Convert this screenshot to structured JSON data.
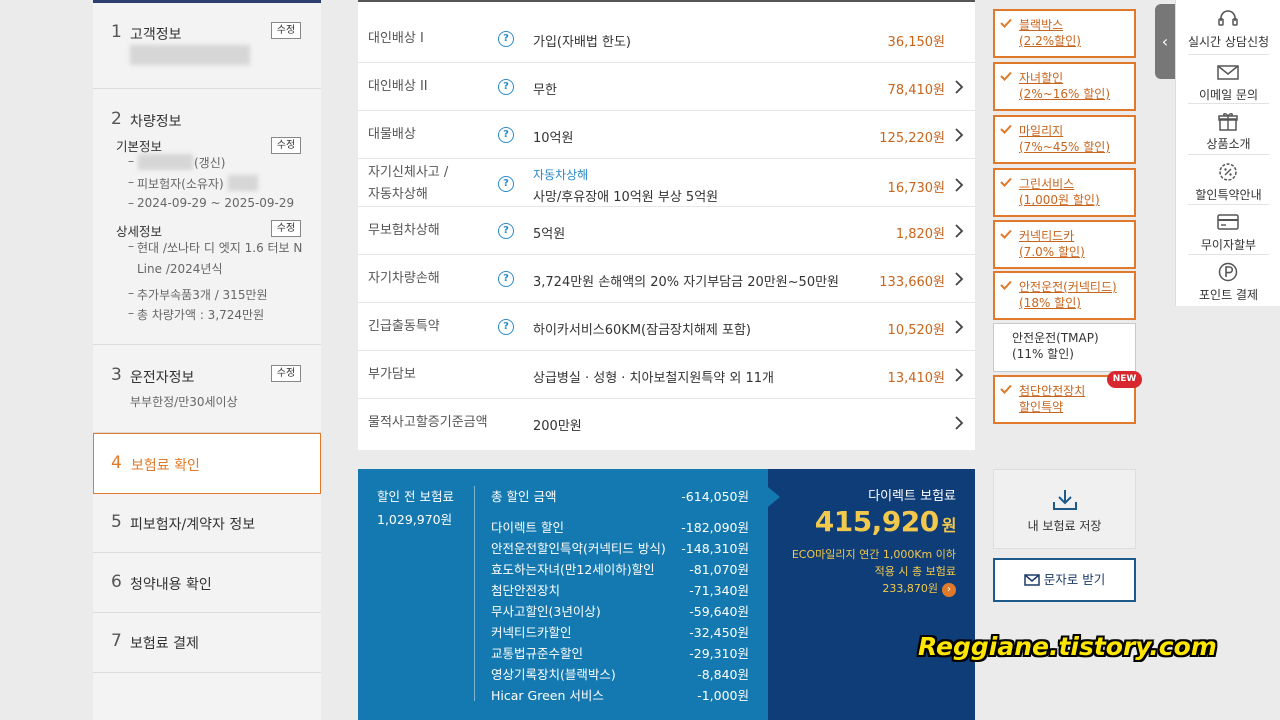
{
  "steps": {
    "edit_label": "수정",
    "s1": {
      "num": "1",
      "title": "고객정보"
    },
    "s2": {
      "num": "2",
      "title": "차량정보",
      "basic_heading": "기본정보",
      "renew": "(갱신)",
      "insured_owner": "피보험자(소유자)",
      "period": "2024-09-29 ~ 2025-09-29",
      "detail_heading": "상세정보",
      "car_line1": "현대 /쏘나타 디 엣지 1.6 터보 N",
      "car_line2": "Line /2024년식",
      "accessories": "추가부속품3개 / 315만원",
      "car_value": "총 차량가액 : 3,724만원"
    },
    "s3": {
      "num": "3",
      "title": "운전자정보",
      "detail": "부부한정/만30세이상"
    },
    "s4": {
      "num": "4",
      "title": "보험료 확인"
    },
    "s5": {
      "num": "5",
      "title": "피보험자/계약자 정보"
    },
    "s6": {
      "num": "6",
      "title": "청약내용 확인"
    },
    "s7": {
      "num": "7",
      "title": "보험료 결제"
    }
  },
  "coverage": {
    "help_glyph": "?",
    "rows": [
      {
        "name": "대인배상 Ⅰ",
        "desc": "가입(자배법 한도)",
        "price": "36,150원"
      },
      {
        "name": "대인배상 II",
        "desc": "무한",
        "price": "78,410원"
      },
      {
        "name": "대물배상",
        "desc": "10억원",
        "price": "125,220원"
      },
      {
        "name_line1": "자기신체사고 /",
        "name_line2": "자동차상해",
        "sub": "자동차상해",
        "desc": "사망/후유장애 10억원 부상 5억원",
        "price": "16,730원"
      },
      {
        "name": "무보험차상해",
        "desc": "5억원",
        "price": "1,820원"
      },
      {
        "name": "자기차량손해",
        "desc": "3,724만원 손해액의 20% 자기부담금 20만원~50만원",
        "price": "133,660원"
      },
      {
        "name": "긴급출동특약",
        "desc": "하이카서비스60KM(잠금장치해제 포함)",
        "price": "10,520원"
      },
      {
        "name": "부가담보",
        "desc": "상급병실 · 성형 · 치아보철지원특약 외 11개",
        "price": "13,410원"
      },
      {
        "name": "물적사고할증기준금액",
        "desc": "200만원"
      }
    ]
  },
  "summary": {
    "before_label": "할인 전 보험료",
    "before_amount": "1,029,970원",
    "total_label": "총 할인 금액",
    "total_amount": "-614,050원",
    "discounts": [
      {
        "name": "다이렉트 할인",
        "amount": "-182,090원"
      },
      {
        "name": "안전운전할인특약(커넥티드 방식)",
        "amount": "-148,310원"
      },
      {
        "name": "효도하는자녀(만12세이하)할인",
        "amount": "-81,070원"
      },
      {
        "name": "첨단안전장치",
        "amount": "-71,340원"
      },
      {
        "name": "무사고할인(3년이상)",
        "amount": "-59,640원"
      },
      {
        "name": "커넥티드카할인",
        "amount": "-32,450원"
      },
      {
        "name": "교통법규준수할인",
        "amount": "-29,310원"
      },
      {
        "name": "영상기록장치(블랙박스)",
        "amount": "-8,840원"
      },
      {
        "name": "Hicar Green 서비스",
        "amount": "-1,000원"
      }
    ],
    "direct_label": "다이렉트 보험료",
    "direct_amount": "415,920",
    "direct_unit": "원",
    "eco_line1": "ECO마일리지 연간 1,000Km 이하",
    "eco_line2": "적용 시 총 보험료",
    "eco_amount": "233,870원",
    "eco_go": "›"
  },
  "discount_list": [
    {
      "line1": "블랙박스",
      "line2": "(2.2%할인)",
      "checked": true
    },
    {
      "line1": "자녀할인",
      "line2": "(2%~16% 할인)",
      "checked": true
    },
    {
      "line1": "마일리지",
      "line2": "(7%~45% 할인)",
      "checked": true
    },
    {
      "line1": "그린서비스",
      "line2": "(1,000원 할인)",
      "checked": true
    },
    {
      "line1": "커넥티드카",
      "line2": "(7.0% 할인)",
      "checked": true
    },
    {
      "line1": "안전운전(커넥티드)",
      "line2": "(18% 할인)",
      "checked": true
    },
    {
      "line1": "안전운전(TMAP)",
      "line2": "(11% 할인)",
      "checked": false
    },
    {
      "line1": "첨단안전장치",
      "line2": "할인특약",
      "checked": true
    }
  ],
  "new_badge": "NEW",
  "actions": {
    "save": "내 보험료 저장",
    "sms": "문자로 받기"
  },
  "quick_menu": {
    "toggle": "‹",
    "items": [
      {
        "label": "실시간 상담신청",
        "icon": "headset-icon"
      },
      {
        "label": "이메일 문의",
        "icon": "mail-icon"
      },
      {
        "label": "상품소개",
        "icon": "gift-icon"
      },
      {
        "label": "할인특약안내",
        "icon": "discount-badge-icon"
      },
      {
        "label": "무이자할부",
        "icon": "card-icon"
      },
      {
        "label": "포인트 결제",
        "icon": "point-icon"
      }
    ]
  },
  "watermark": "Reggiane.tistory.com",
  "colors": {
    "accent": "#e07a2a",
    "price": "#c9641c",
    "summary_blue": "#1479b0",
    "direct_navy": "#0e3d78",
    "direct_gold": "#f2c94c"
  }
}
